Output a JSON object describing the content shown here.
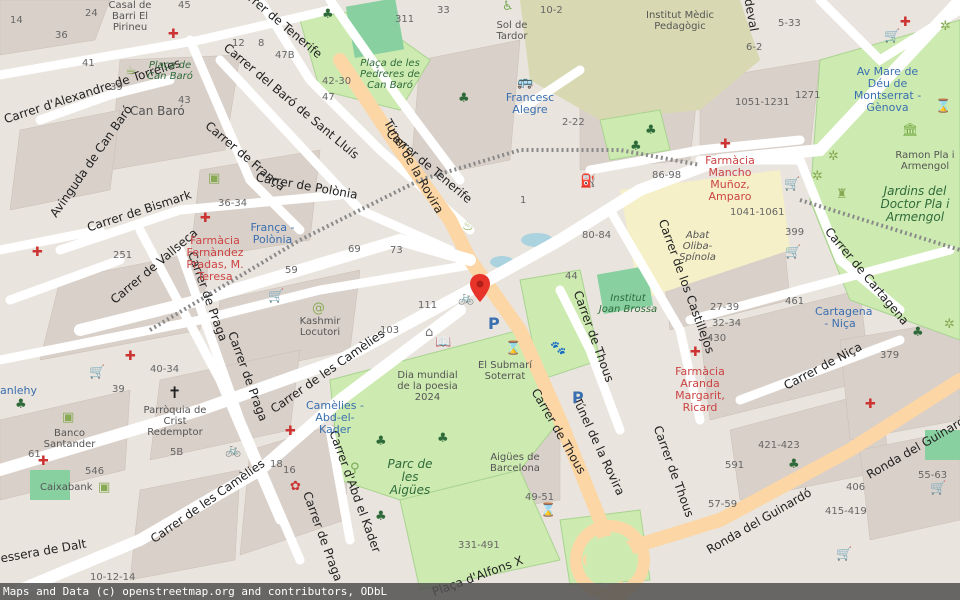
{
  "attribution": "Maps and Data (c) openstreetmap.org and contributors, ODbL",
  "colors": {
    "background": "#f2efe9",
    "building": "#d9d0c9",
    "park": "#cdebb0",
    "road": "#ffffff",
    "primary_road": "#fcd6a4",
    "marker": "#e8332a"
  },
  "streets": {
    "tenerife_top": "Carrer de Tenerife",
    "tenerife_mid": "Carrer de Tenerife",
    "alexandre": "Carrer d'Alexandre de Torrelles",
    "baro_sant_lluis": "Carrer del Baró de Sant Lluís",
    "avinguda_can_baro": "Avinguda de Can Baró",
    "franca": "Carrer de França",
    "polonia": "Carrer de Polònia",
    "bismark": "Carrer de Bismark",
    "vallseca": "Carrer de Vallseca",
    "praga_top": "Carrer de Praga",
    "praga_mid": "Carrer de Praga",
    "praga_bottom": "Carrer de Praga",
    "camelies_mid": "Carrer de les Camèlies",
    "camelies_bottom": "Carrer de les Camèlies",
    "abd_el_kader": "Carrer d'Abd el Kader",
    "tunel_rovira_top": "Túnel de la Rovira",
    "tunel_rovira_bottom": "Túnel de la Rovira",
    "thous_1": "Carrer de Thous",
    "thous_2": "Carrer de Thous",
    "thous_3": "Carrer de Thous",
    "castillejos": "Carrer de los Castillejos",
    "nica": "Carrer de Niça",
    "cartagena": "Carrer de Cartagena",
    "ronda_guinardo_1": "Ronda del Guinardó",
    "ronda_guinardo_2": "Ronda del Guinardó",
    "placa_alfons": "Plaça d'Alfons X",
    "lesseps": "essera de Dalt",
    "cadeval": "adeval"
  },
  "places": {
    "can_baro": "Can Baró",
    "placa_can_baro": "Plaça de Can Baró",
    "placa_pedreres": "Plaça de les Pedreres de Can Baró",
    "parc_aigues": "Parc de les Aigües",
    "jardins_doctor": "Jardins del Doctor Pla i Armengol"
  },
  "pois": {
    "casal_barri": "Casal de Barri El Pirineu",
    "sol_tardor": "Sol de Tardor",
    "institut_medic": "Institut Mèdic Pedagògic",
    "francesc_alegre": "Francesc Alegre",
    "av_mare_deu": "Av Mare de Déu de Montserrat - Gènova",
    "ramon_pla": "Ramon Pla i Armengol",
    "farmacia_mancho": "Farmàcia Mancho Muñoz, Amparo",
    "abat_oliba": "Abat Oliba-Spínola",
    "institut_joan_brossa": "Institut Joan Brossa",
    "farmacia_pradas": "Farmàcia Fernàndez Pradas, M. Teresa",
    "franca_polonia": "França - Polònia",
    "kashmir": "Kashmir Locutori",
    "parroquia": "Parròquia de Crist Redemptor",
    "banco_santander": "Banco Santander",
    "caixabank": "Caixabank",
    "dia_mundial": "Dia mundial de la poesia 2024",
    "submari": "El Submarí Soterrat",
    "camelies_abd": "Camèlies - Abd-el-Kader",
    "aigues_barcelona": "Aigües de Barcelona",
    "cartagena_nica": "Cartagena - Niça",
    "farmacia_aranda": "Farmàcia Aranda Margarit, Ricard",
    "anlehy": "anlehy"
  },
  "house_numbers": {
    "n1": "36",
    "n2": "45",
    "n3": "24",
    "n4": "14",
    "n5": "41",
    "n6": "39",
    "n7": "47",
    "n8": "47B",
    "n9": "12",
    "n10": "8",
    "n11": "311",
    "n12": "33",
    "n13": "10-2",
    "n14": "2-22",
    "n15": "42-30",
    "n16": "47",
    "n17": "43",
    "n18": "1",
    "n19": "86-98",
    "n20": "1041-1061",
    "n21": "1051-1231",
    "n22": "1271",
    "n23": "80-84",
    "n24": "399",
    "n25": "44",
    "n26": "27-39",
    "n27": "32-34",
    "n28": "461",
    "n29": "430",
    "n30": "379",
    "n31": "36-34",
    "n32": "251",
    "n33": "59",
    "n34": "111",
    "n35": "103",
    "n36": "73",
    "n37": "69",
    "n38": "40-34",
    "n39": "61",
    "n40": "546",
    "n41": "5B",
    "n42": "18",
    "n43": "16",
    "n44": "331-491",
    "n45": "49-51",
    "n46": "591",
    "n47": "421-423",
    "n48": "415-419",
    "n49": "406",
    "n50": "57-59",
    "n51": "55-63",
    "n52": "39",
    "n53": "10-12-14",
    "n54": "5-33",
    "n55": "6-2"
  },
  "marker": {
    "name": "selected-location"
  }
}
